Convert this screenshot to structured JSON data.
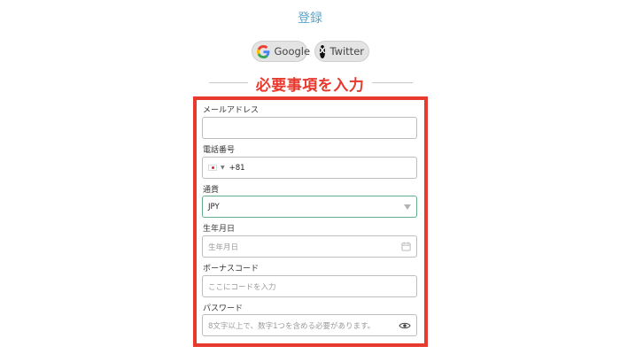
{
  "page": {
    "title": "登録"
  },
  "social": {
    "google_label": "Google",
    "twitter_label": "Twitter",
    "twitter_icon_text": "X"
  },
  "section": {
    "heading": "必要事項を入力",
    "highlight_color": "#e8392e"
  },
  "form": {
    "email": {
      "label": "メールアドレス",
      "value": ""
    },
    "phone": {
      "label": "電話番号",
      "country_flag": "japan-flag-icon",
      "country_code": "+81",
      "value": ""
    },
    "currency": {
      "label": "通貨",
      "selected": "JPY"
    },
    "birthdate": {
      "label": "生年月日",
      "placeholder": "生年月日"
    },
    "bonus_code": {
      "label": "ボーナスコード",
      "placeholder": "ここにコードを入力"
    },
    "password": {
      "label": "パスワード",
      "placeholder": "8文字以上で、数字1つを含める必要があります。"
    }
  },
  "colors": {
    "title": "#5aa6c9",
    "accent_red": "#e8392e",
    "focus_green": "#5fb08a"
  }
}
